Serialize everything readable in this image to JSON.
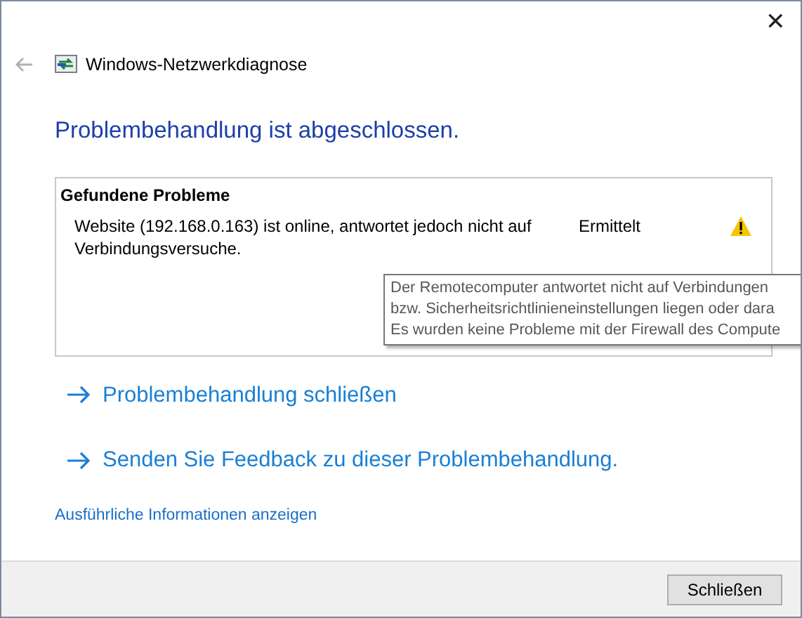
{
  "window": {
    "title": "Windows-Netzwerkdiagnose",
    "close": "✕"
  },
  "heading": "Problembehandlung ist abgeschlossen.",
  "problems": {
    "title": "Gefundene Probleme",
    "rows": [
      {
        "description": "Website (192.168.0.163) ist online, antwortet jedoch nicht auf Verbindungsversuche.",
        "status": "Ermittelt",
        "kind": "warning"
      }
    ]
  },
  "tooltip": {
    "lines": [
      "Der Remotecomputer antwortet nicht auf Verbindungen",
      "bzw. Sicherheitsrichtlinieneinstellungen liegen oder dara",
      "Es wurden keine Probleme mit der Firewall des Compute"
    ]
  },
  "actions": [
    {
      "label": "Problembehandlung schließen"
    },
    {
      "label": "Senden Sie Feedback zu dieser Problembehandlung."
    }
  ],
  "details_link": "Ausführliche Informationen anzeigen",
  "buttons": [
    {
      "label": "Schließen"
    }
  ]
}
